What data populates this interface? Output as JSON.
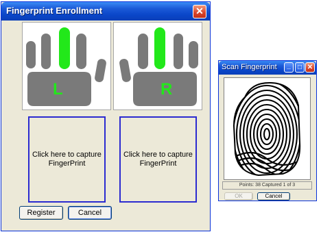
{
  "enroll_window": {
    "title": "Fingerprint Enrollment",
    "close_glyph": "✕",
    "left_hand": {
      "label": "L",
      "highlighted_finger": "middle"
    },
    "right_hand": {
      "label": "R",
      "highlighted_finger": "middle"
    },
    "capture_left_text": "Click here to capture FingerPrint",
    "capture_right_text": "Click here to capture FingerPrint",
    "register_label": "Register",
    "cancel_label": "Cancel"
  },
  "scan_window": {
    "title": "Scan Fingerprint",
    "minimize_glyph": "_",
    "maximize_glyph": "□",
    "close_glyph": "✕",
    "status_text": "Points: 38 Captured 1 of 3",
    "ok_label": "OK",
    "cancel_label": "Cancel"
  },
  "colors": {
    "highlight_finger": "#22e81a",
    "hand_gray": "#7a7a7a",
    "capture_border": "#2a2ad0",
    "label_green": "#22e81a"
  },
  "icons": [
    "close-icon",
    "minimize-icon",
    "maximize-icon",
    "hand-icon",
    "fingerprint-icon"
  ]
}
